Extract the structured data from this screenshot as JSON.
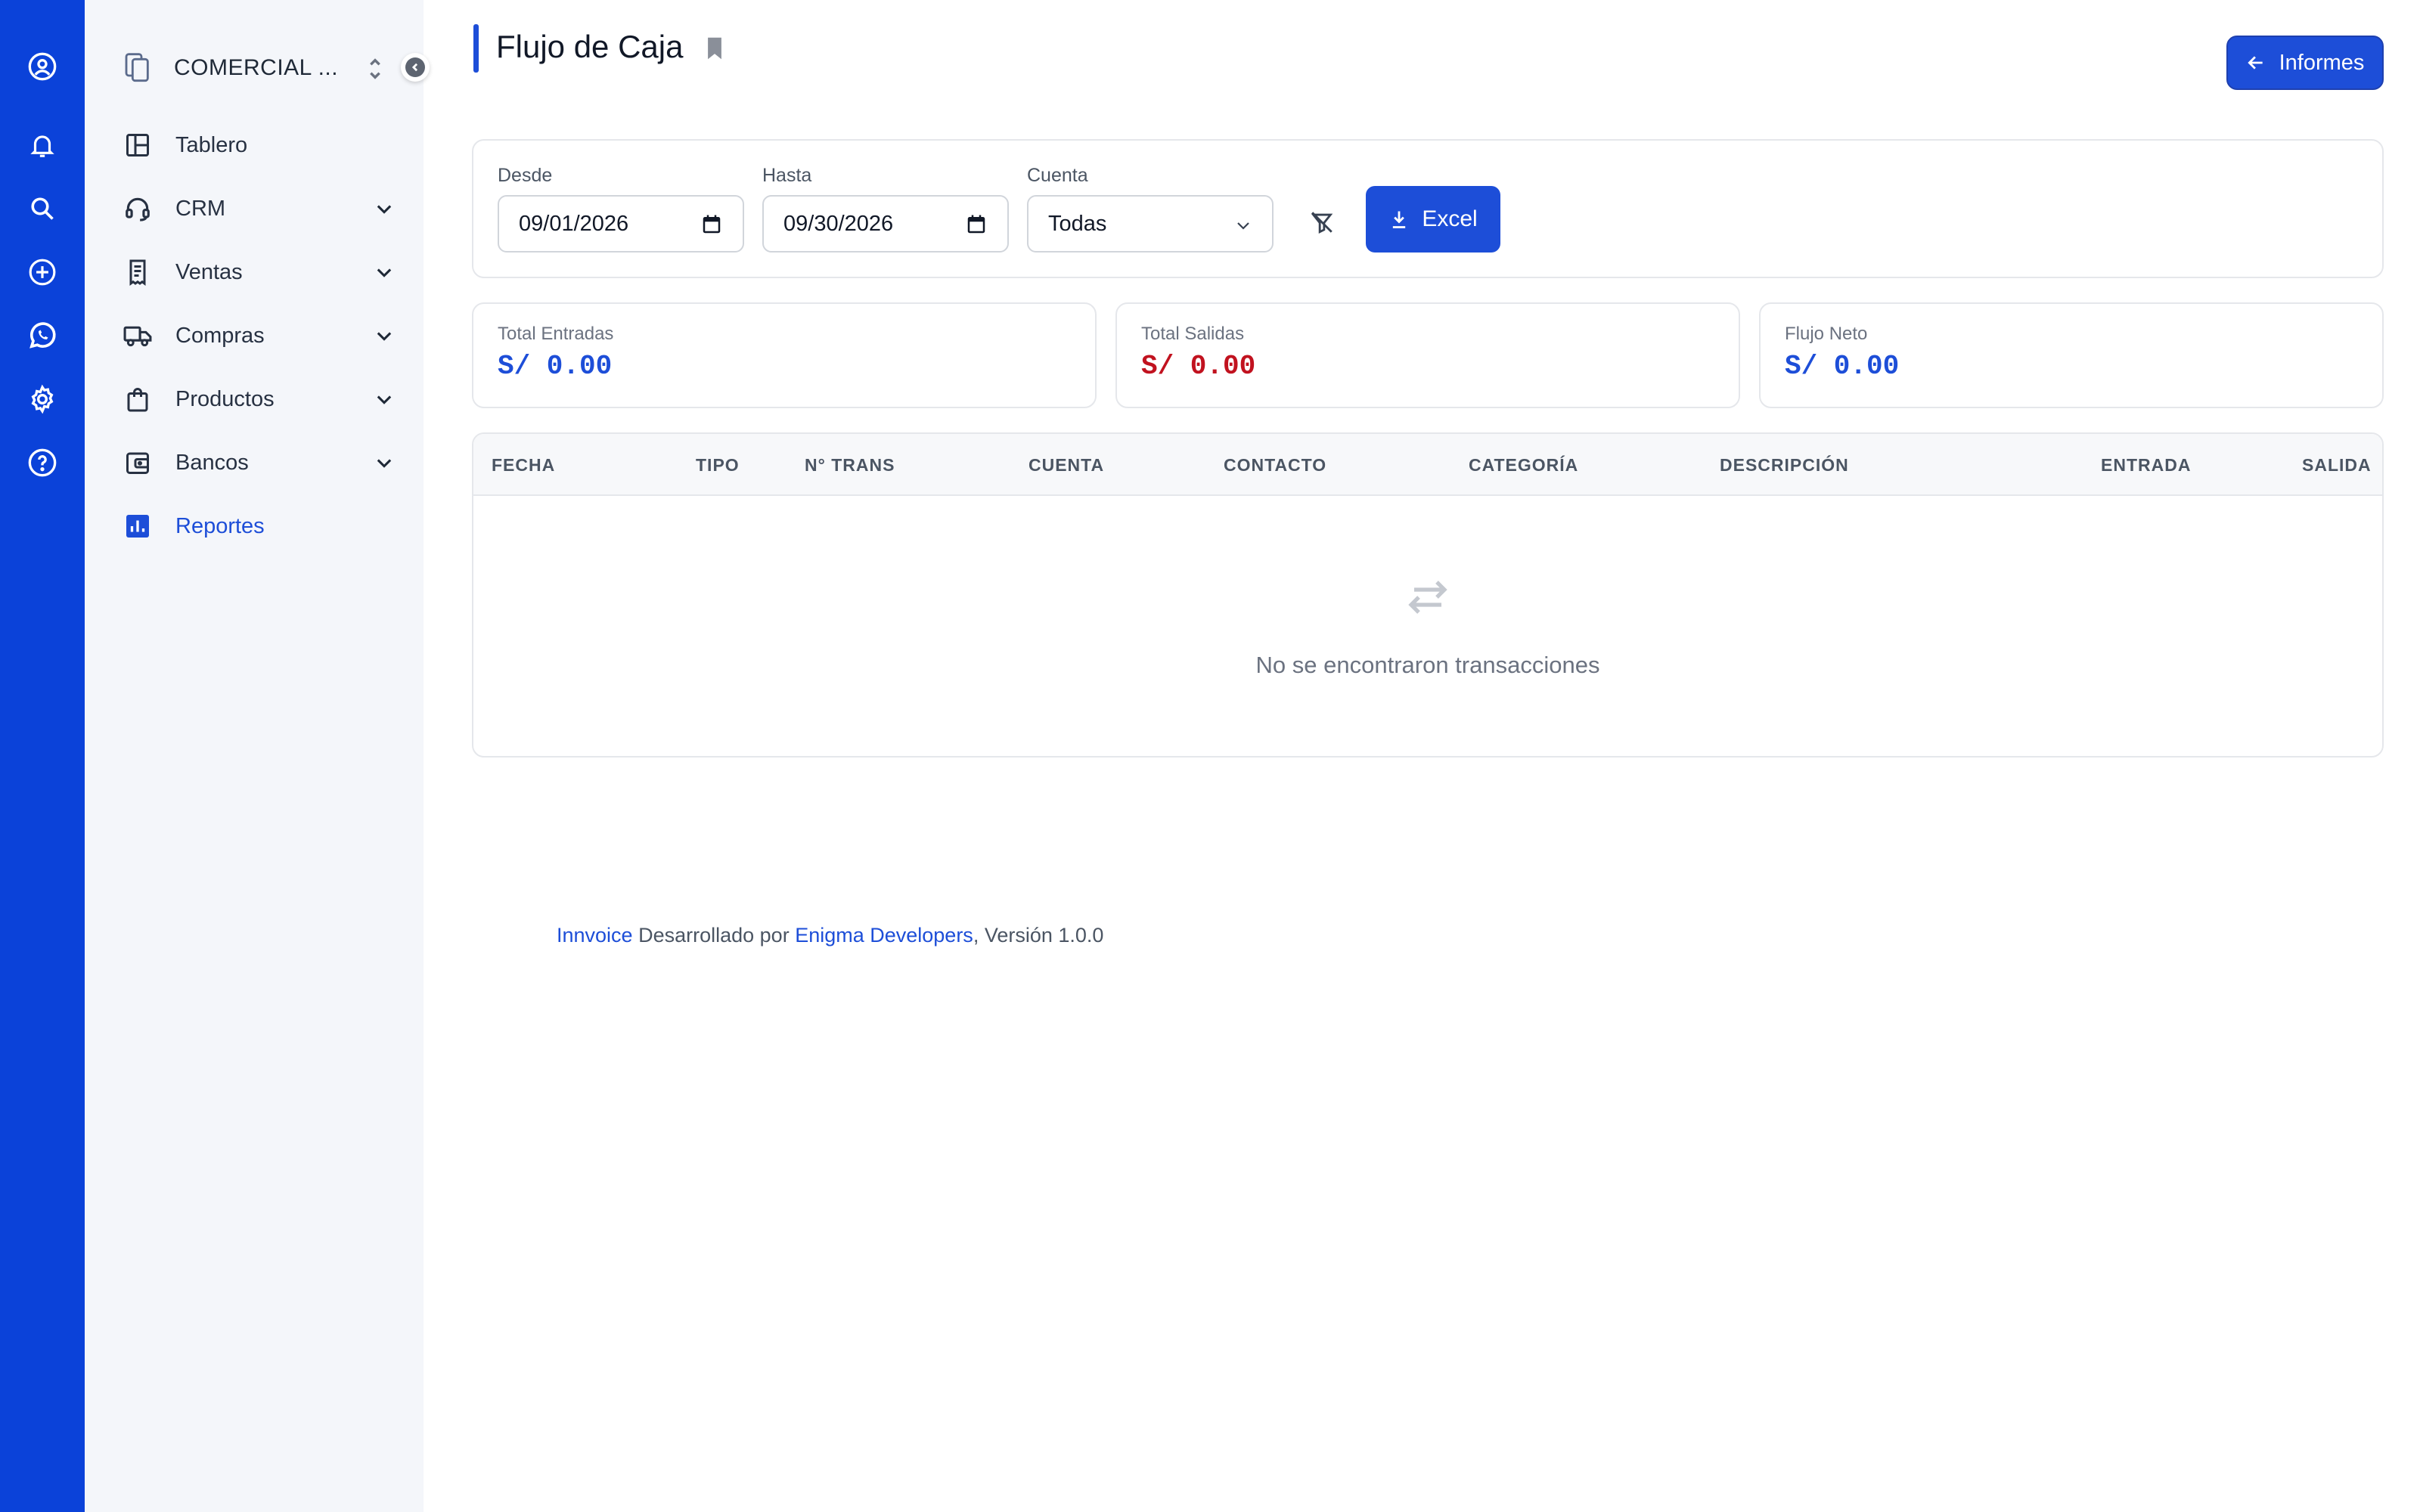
{
  "rail": {
    "items": [
      {
        "icon": "user-circle-icon"
      },
      {
        "icon": "bell-icon"
      },
      {
        "icon": "search-icon"
      },
      {
        "icon": "plus-circle-icon"
      },
      {
        "icon": "whatsapp-icon"
      },
      {
        "icon": "gear-icon"
      },
      {
        "icon": "help-icon"
      }
    ]
  },
  "sidebar": {
    "company": "COMERCIAL ...",
    "items": [
      {
        "label": "Tablero",
        "icon": "dashboard-icon",
        "expandable": false
      },
      {
        "label": "CRM",
        "icon": "headset-icon",
        "expandable": true
      },
      {
        "label": "Ventas",
        "icon": "receipt-icon",
        "expandable": true
      },
      {
        "label": "Compras",
        "icon": "truck-icon",
        "expandable": true
      },
      {
        "label": "Productos",
        "icon": "shopping-bag-icon",
        "expandable": true
      },
      {
        "label": "Bancos",
        "icon": "wallet-icon",
        "expandable": true
      },
      {
        "label": "Reportes",
        "icon": "bar-chart-icon",
        "expandable": false,
        "active": true
      }
    ]
  },
  "header": {
    "title": "Flujo de Caja",
    "informes_label": "Informes"
  },
  "filters": {
    "desde_label": "Desde",
    "desde_value": "09/01/2026",
    "hasta_label": "Hasta",
    "hasta_value": "09/30/2026",
    "cuenta_label": "Cuenta",
    "cuenta_value": "Todas",
    "excel_label": "Excel"
  },
  "stats": [
    {
      "label": "Total Entradas",
      "value": "S/ 0.00",
      "color": "#1d4ed8"
    },
    {
      "label": "Total Salidas",
      "value": "S/ 0.00",
      "color": "#c1121f"
    },
    {
      "label": "Flujo Neto",
      "value": "S/ 0.00",
      "color": "#1d4ed8"
    }
  ],
  "table": {
    "columns": [
      "FECHA",
      "TIPO",
      "N° TRANS",
      "CUENTA",
      "CONTACTO",
      "CATEGORÍA",
      "DESCRIPCIÓN",
      "ENTRADA",
      "SALIDA"
    ],
    "empty_text": "No se encontraron transacciones"
  },
  "footer": {
    "brand": "Innvoice",
    "developed_by": " Desarrollado por ",
    "company": "Enigma Developers",
    "version": ", Versión 1.0.0"
  },
  "colors": {
    "brand": "#0b42d9",
    "accent": "#1d4ed8",
    "negative": "#c1121f"
  }
}
